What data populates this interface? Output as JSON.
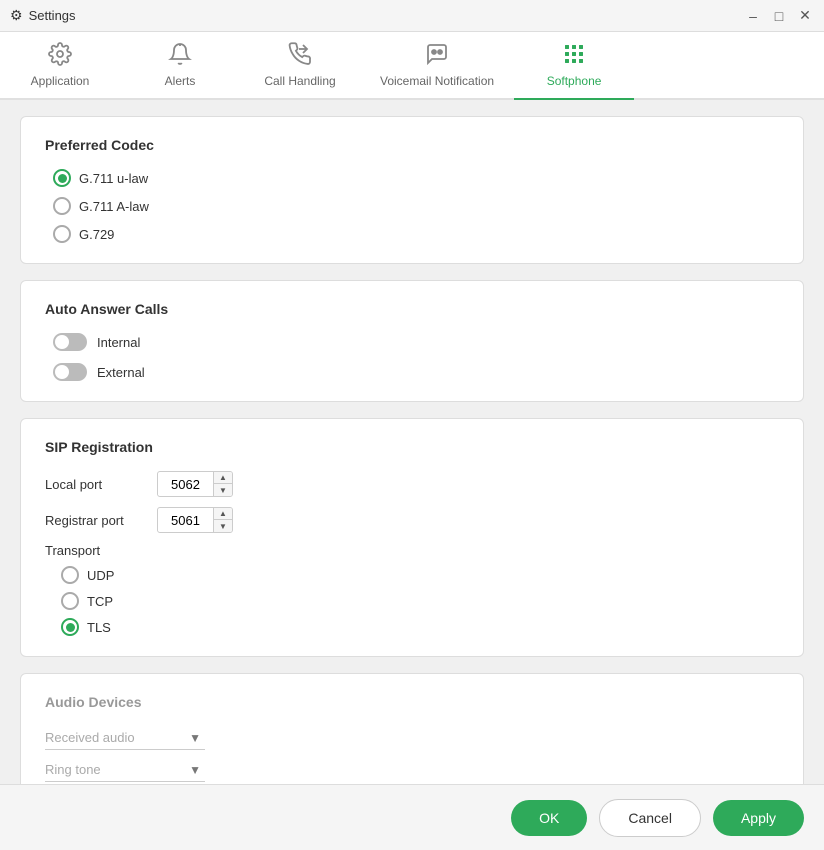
{
  "window": {
    "title": "Settings",
    "icon": "⚙"
  },
  "tabs": [
    {
      "id": "application",
      "label": "Application",
      "icon": "⚙",
      "active": false
    },
    {
      "id": "alerts",
      "label": "Alerts",
      "icon": "🔔",
      "active": false
    },
    {
      "id": "call-handling",
      "label": "Call Handling",
      "icon": "📞",
      "active": false
    },
    {
      "id": "voicemail-notification",
      "label": "Voicemail Notification",
      "icon": "📳",
      "active": false
    },
    {
      "id": "softphone",
      "label": "Softphone",
      "icon": "⊞",
      "active": true
    }
  ],
  "sections": {
    "preferred_codec": {
      "title": "Preferred Codec",
      "options": [
        {
          "id": "g711u",
          "label": "G.711 u-law",
          "checked": true
        },
        {
          "id": "g711a",
          "label": "G.711 A-law",
          "checked": false
        },
        {
          "id": "g729",
          "label": "G.729",
          "checked": false
        }
      ]
    },
    "auto_answer": {
      "title": "Auto Answer Calls",
      "toggles": [
        {
          "id": "internal",
          "label": "Internal",
          "on": false
        },
        {
          "id": "external",
          "label": "External",
          "on": false
        }
      ]
    },
    "sip_registration": {
      "title": "SIP Registration",
      "local_port_label": "Local port",
      "local_port_value": "5062",
      "registrar_port_label": "Registrar port",
      "registrar_port_value": "5061",
      "transport_label": "Transport",
      "transport_options": [
        {
          "id": "udp",
          "label": "UDP",
          "checked": false
        },
        {
          "id": "tcp",
          "label": "TCP",
          "checked": false
        },
        {
          "id": "tls",
          "label": "TLS",
          "checked": true
        }
      ]
    },
    "audio_devices": {
      "title": "Audio Devices",
      "received_audio_label": "Received audio",
      "ring_tone_label": "Ring tone"
    }
  },
  "footer": {
    "ok_label": "OK",
    "cancel_label": "Cancel",
    "apply_label": "Apply"
  }
}
